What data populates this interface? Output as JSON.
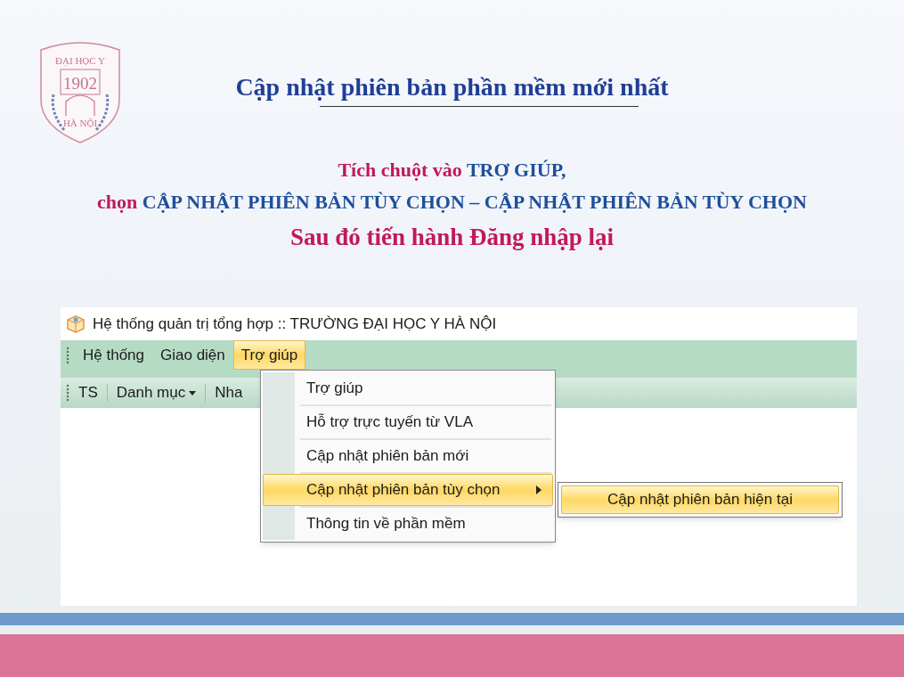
{
  "slide": {
    "logo": {
      "top_text": "ĐẠI HỌC Y",
      "year": "1902",
      "bottom_text": "HÀ NỘI"
    },
    "title": "Cập nhật phiên bản phần mềm mới nhất",
    "instructions": [
      [
        {
          "text": "Tích chuột vào ",
          "kind": "plain"
        },
        {
          "text": "TRỢ GIÚP,",
          "kind": "highlight"
        }
      ],
      [
        {
          "text": "chọn ",
          "kind": "plain"
        },
        {
          "text": "CẬP NHẬT PHIÊN BẢN TÙY CHỌN – CẬP NHẬT PHIÊN BẢN TÙY CHỌN",
          "kind": "highlight"
        }
      ],
      [
        {
          "text": "Sau đó tiến hành Đăng nhập lại",
          "kind": "plain"
        }
      ]
    ]
  },
  "app": {
    "window_title": "Hệ thống quản trị tổng hợp :: TRƯỜNG ĐẠI HỌC Y HÀ NỘI",
    "menu_bar": [
      {
        "label": "Hệ thống",
        "selected": false
      },
      {
        "label": "Giao diện",
        "selected": false
      },
      {
        "label": "Trợ giúp",
        "selected": true
      }
    ],
    "toolbar": [
      {
        "label": "TS",
        "has_dropdown": false
      },
      {
        "label": "Danh mục",
        "has_dropdown": true
      },
      {
        "label": "Nha",
        "has_dropdown": false
      }
    ],
    "dropdown": [
      {
        "label": "Trợ giúp",
        "selected": false,
        "has_submenu": false
      },
      {
        "label": "Hỗ trợ trực tuyến từ VLA",
        "selected": false,
        "has_submenu": false
      },
      {
        "label": "Cập nhật phiên bản mới",
        "selected": false,
        "has_submenu": false
      },
      {
        "label": "Cập nhật phiên bản tùy chọn",
        "selected": true,
        "has_submenu": true
      },
      {
        "label": "Thông tin về phần mềm",
        "selected": false,
        "has_submenu": false
      }
    ],
    "submenu": [
      {
        "label": "Cập nhật phiên bản hiện tại",
        "selected": true
      }
    ]
  }
}
